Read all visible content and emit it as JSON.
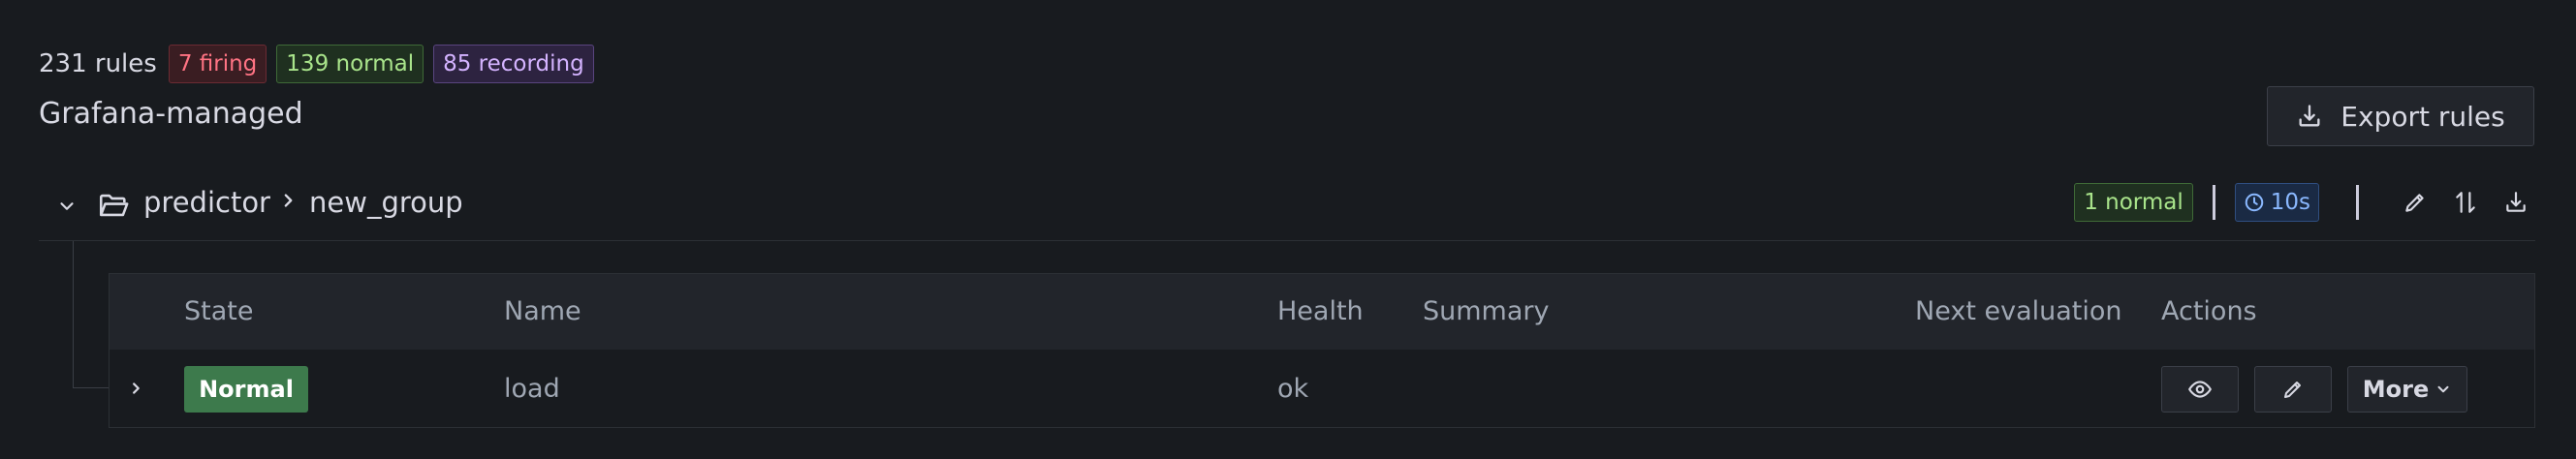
{
  "summary": {
    "total": "231 rules",
    "firing": "7 firing",
    "normal": "139 normal",
    "recording": "85 recording"
  },
  "source_title": "Grafana-managed",
  "export_button": {
    "label": "Export rules",
    "icon": "download-icon"
  },
  "group": {
    "folder": "predictor",
    "separator": "›",
    "name": "new_group",
    "state_badge": "1 normal",
    "interval": "10s",
    "icons": [
      "chevron-down-icon",
      "folder-open-icon",
      "clock-icon",
      "pencil-icon",
      "sort-icon",
      "download-icon"
    ]
  },
  "table": {
    "columns": {
      "state": "State",
      "name": "Name",
      "health": "Health",
      "summary": "Summary",
      "next_eval": "Next evaluation",
      "actions": "Actions"
    },
    "rows": [
      {
        "state": "Normal",
        "name": "load",
        "health": "ok",
        "summary": "",
        "next_eval": "",
        "more_label": "More"
      }
    ]
  },
  "colors": {
    "background": "#181b1f",
    "firing": "#ff7383",
    "normal": "#a9e48b",
    "recording": "#d4b3ff",
    "interval": "#8ab8ff",
    "state_normal": "#3d7a4c"
  }
}
